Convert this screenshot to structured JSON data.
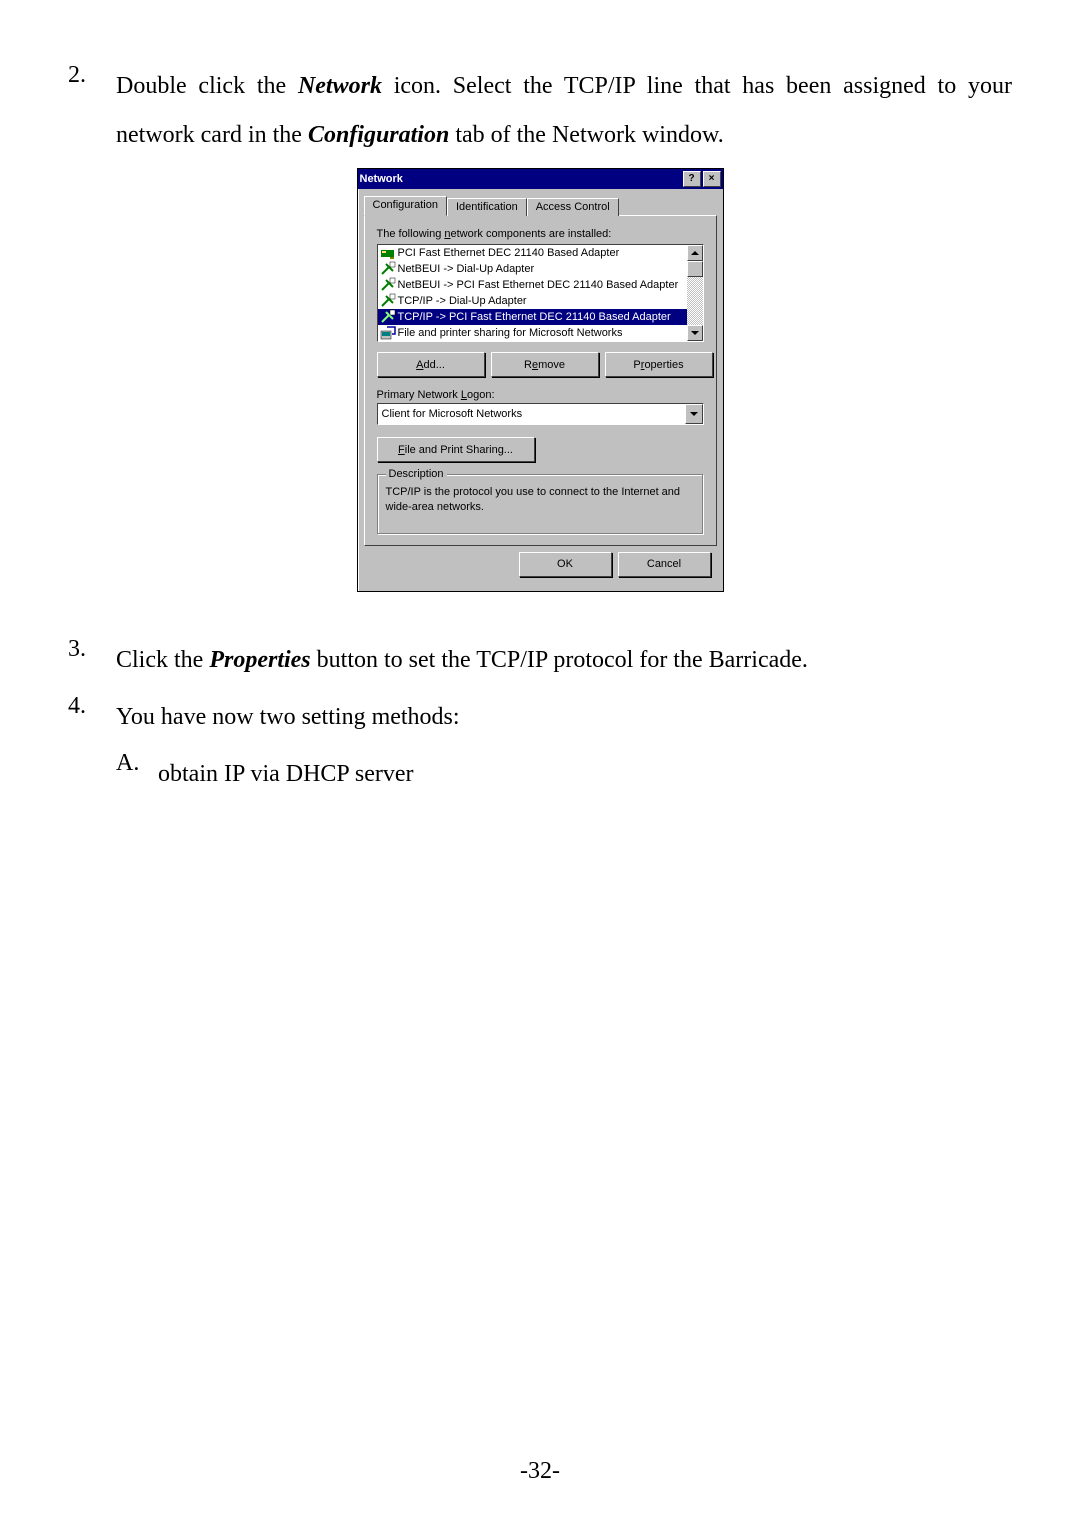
{
  "doc": {
    "step2_num": "2.",
    "step2_a": "Double click the ",
    "step2_b": "Network",
    "step2_c": " icon. Select the TCP/IP line that has been assigned to your network card in the ",
    "step2_d": "Configuration",
    "step2_e": " tab of the Network window.",
    "step3_num": "3.",
    "step3_a": "Click the ",
    "step3_b": "Properties",
    "step3_c": " button to set the TCP/IP protocol for the Barricade.",
    "step4_num": "4.",
    "step4_text": "You have now two setting methods:",
    "stepA_letter": "A.",
    "stepA_text": "obtain IP via DHCP server",
    "page_number": "-32-"
  },
  "dialog": {
    "title": "Network",
    "help_glyph": "?",
    "close_glyph": "×",
    "tabs": {
      "configuration": "Configuration",
      "identification": "Identification",
      "access": "Access Control"
    },
    "list_label_pre": "The following ",
    "list_label_u": "n",
    "list_label_post": "etwork components are installed:",
    "items": [
      {
        "text": "PCI Fast Ethernet DEC 21140 Based Adapter",
        "type": "card",
        "selected": false
      },
      {
        "text": "NetBEUI -> Dial-Up Adapter",
        "type": "proto",
        "selected": false
      },
      {
        "text": "NetBEUI -> PCI Fast Ethernet DEC 21140 Based Adapter",
        "type": "proto",
        "selected": false
      },
      {
        "text": "TCP/IP -> Dial-Up Adapter",
        "type": "proto",
        "selected": false
      },
      {
        "text": "TCP/IP -> PCI Fast Ethernet DEC 21140 Based Adapter",
        "type": "proto",
        "selected": true
      },
      {
        "text": "File and printer sharing for Microsoft Networks",
        "type": "share",
        "selected": false
      }
    ],
    "buttons": {
      "add_u": "A",
      "add_post": "dd...",
      "remove_pre": "R",
      "remove_u": "e",
      "remove_post": "move",
      "properties_pre": "P",
      "properties_u": "r",
      "properties_post": "operties",
      "fps_u": "F",
      "fps_post": "ile and Print Sharing...",
      "ok": "OK",
      "cancel": "Cancel"
    },
    "logon_label_pre": "Primary Network ",
    "logon_label_u": "L",
    "logon_label_post": "ogon:",
    "logon_value": "Client for Microsoft Networks",
    "desc_legend": "Description",
    "desc_text": "TCP/IP is the protocol you use to connect to the Internet and wide-area networks."
  }
}
